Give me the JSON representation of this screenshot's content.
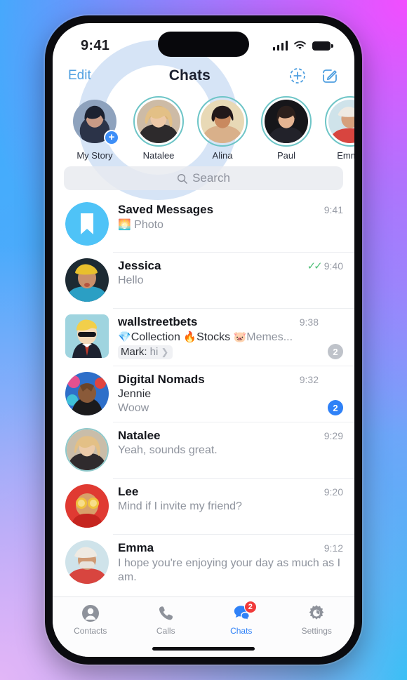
{
  "status_bar": {
    "time": "9:41",
    "signal_icon": "cellular-bars-icon",
    "wifi_icon": "wifi-icon",
    "battery_icon": "battery-icon"
  },
  "nav": {
    "edit_label": "Edit",
    "title": "Chats",
    "add_story_icon": "add-story-circle-plus-icon",
    "compose_icon": "compose-pencil-square-icon"
  },
  "stories": [
    {
      "name": "My Story",
      "has_ring": false,
      "has_plus": true
    },
    {
      "name": "Natalee",
      "has_ring": true,
      "has_plus": false
    },
    {
      "name": "Alina",
      "has_ring": true,
      "has_plus": false
    },
    {
      "name": "Paul",
      "has_ring": true,
      "has_plus": false
    },
    {
      "name": "Emma",
      "has_ring": true,
      "has_plus": false
    }
  ],
  "search": {
    "placeholder": "Search",
    "icon": "search-magnifier-icon"
  },
  "chats": [
    {
      "title": "Saved Messages",
      "time": "9:41",
      "preview": "Photo",
      "preview_emoji": "photo-thumbnail",
      "avatar": "saved-messages-bookmark-icon"
    },
    {
      "title": "Jessica",
      "time": "9:40",
      "preview": "Hello",
      "read_checks": "read-double-check-icon",
      "avatar": "jessica-avatar"
    },
    {
      "title": "wallstreetbets",
      "time": "9:38",
      "preview": "Collection  Stocks  Memes...",
      "preview_emojis": [
        "💎",
        "🔥",
        "🐷"
      ],
      "preview_parts": [
        "Collection",
        "Stocks",
        "Memes..."
      ],
      "reply_sender": "Mark:",
      "reply_text": "hi",
      "badge": "2",
      "badge_color": "#bfc3ca",
      "avatar": "wallstreetbets-avatar"
    },
    {
      "title": "Digital Nomads",
      "time": "9:32",
      "sender": "Jennie",
      "preview": "Woow",
      "badge": "2",
      "badge_color": "#2f81f7",
      "avatar": "digital-nomads-avatar"
    },
    {
      "title": "Natalee",
      "time": "9:29",
      "preview": "Yeah, sounds great.",
      "avatar": "natalee-avatar"
    },
    {
      "title": "Lee",
      "time": "9:20",
      "preview": "Mind if I invite my friend?",
      "avatar": "lee-avatar"
    },
    {
      "title": "Emma",
      "time": "9:12",
      "preview": "I hope you're enjoying your day as much as I am.",
      "avatar": "emma-avatar"
    }
  ],
  "tabs": [
    {
      "label": "Contacts",
      "icon": "person-circle-icon",
      "active": false
    },
    {
      "label": "Calls",
      "icon": "phone-icon",
      "active": false
    },
    {
      "label": "Chats",
      "icon": "chat-bubbles-icon",
      "active": true,
      "badge": "2"
    },
    {
      "label": "Settings",
      "icon": "gear-icon",
      "active": false
    }
  ],
  "colors": {
    "accent": "#2f81f7",
    "nav_link": "#4f9fe0",
    "story_ring": "#6ec5c7",
    "badge_red": "#f03a3a",
    "read_check": "#4fc078"
  }
}
